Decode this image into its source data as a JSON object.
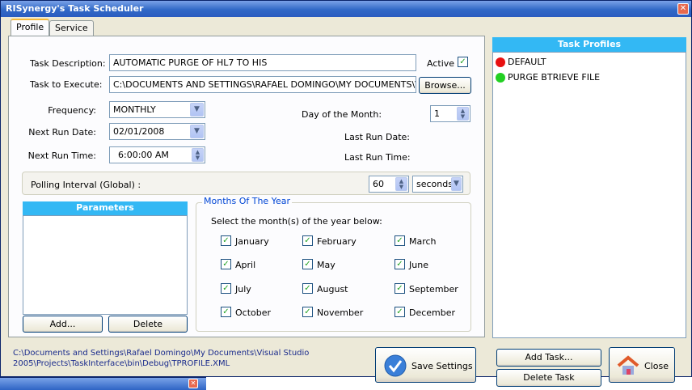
{
  "window": {
    "title": "RISynergy's Task Scheduler"
  },
  "tabs": [
    {
      "label": "Profile",
      "active": true
    },
    {
      "label": "Service",
      "active": false
    }
  ],
  "form": {
    "task_description_label": "Task Description:",
    "task_description_value": "AUTOMATIC PURGE OF HL7 TO HIS",
    "active_label": "Active",
    "active_checked": true,
    "task_to_execute_label": "Task to Execute:",
    "task_to_execute_value": "C:\\DOCUMENTS AND SETTINGS\\RAFAEL DOMINGO\\MY DOCUMENTS\\VISUAL",
    "browse_label": "Browse...",
    "frequency_label": "Frequency:",
    "frequency_value": "MONTHLY",
    "day_of_month_label": "Day of the Month:",
    "day_of_month_value": "1",
    "next_run_date_label": "Next Run Date:",
    "next_run_date_value": "02/01/2008",
    "last_run_date_label": "Last Run Date:",
    "next_run_time_label": "Next Run Time:",
    "next_run_time_value": "6:00:00 AM",
    "last_run_time_label": "Last Run Time:",
    "polling_label": "Polling Interval (Global) :",
    "polling_value": "60",
    "polling_unit": "seconds"
  },
  "parameters": {
    "header": "Parameters",
    "add_label": "Add...",
    "delete_label": "Delete"
  },
  "months": {
    "legend": "Months Of The Year",
    "instruction": "Select the month(s) of the year below:",
    "items": [
      {
        "label": "January",
        "checked": true
      },
      {
        "label": "February",
        "checked": true
      },
      {
        "label": "March",
        "checked": true
      },
      {
        "label": "April",
        "checked": true
      },
      {
        "label": "May",
        "checked": true
      },
      {
        "label": "June",
        "checked": true
      },
      {
        "label": "July",
        "checked": true
      },
      {
        "label": "August",
        "checked": true
      },
      {
        "label": "September",
        "checked": true
      },
      {
        "label": "October",
        "checked": true
      },
      {
        "label": "November",
        "checked": true
      },
      {
        "label": "December",
        "checked": true
      }
    ]
  },
  "task_profiles": {
    "header": "Task Profiles",
    "items": [
      {
        "label": "DEFAULT",
        "status_color": "#e81010"
      },
      {
        "label": "PURGE BTRIEVE FILE",
        "status_color": "#22d022"
      }
    ]
  },
  "footer": {
    "path_line1": "C:\\Documents and Settings\\Rafael Domingo\\My Documents\\Visual Studio",
    "path_line2": "2005\\Projects\\TaskInterface\\bin\\Debug\\TPROFILE.XML",
    "save_label": "Save Settings",
    "add_task_label": "Add Task...",
    "delete_task_label": "Delete Task",
    "close_label": "Close"
  },
  "colors": {
    "accent_header": "#33b8f4",
    "legend_text": "#0046d5",
    "path_text": "#1a2b8c"
  }
}
